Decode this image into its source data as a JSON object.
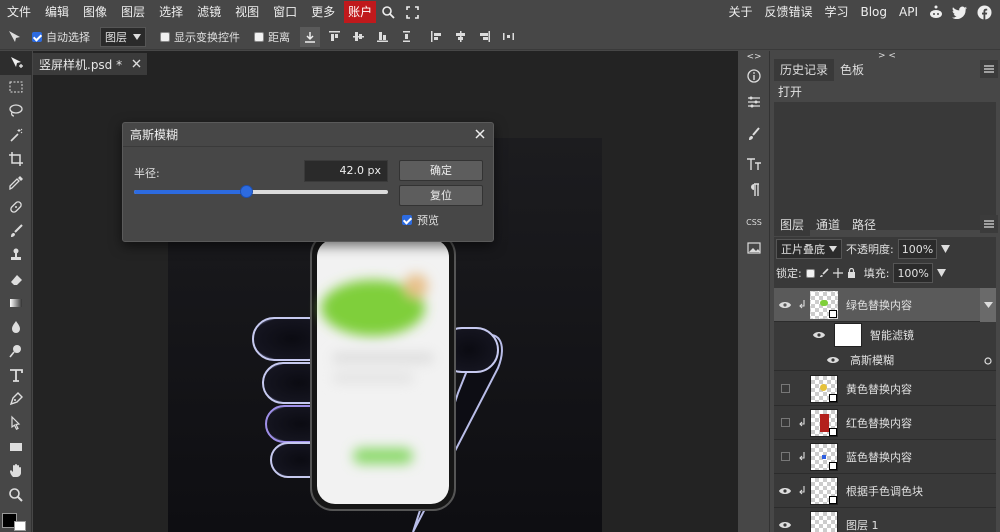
{
  "menubar": {
    "items": [
      "文件",
      "编辑",
      "图像",
      "图层",
      "选择",
      "滤镜",
      "视图",
      "窗口",
      "更多"
    ],
    "account_label": "账户",
    "right_items": [
      "关于",
      "反馈错误",
      "学习",
      "Blog",
      "API"
    ],
    "account_color": "#c0191c"
  },
  "options": {
    "auto_select_label": "自动选择",
    "auto_select_checked": true,
    "target_value": "图层",
    "show_transform_label": "显示变换控件",
    "distance_label": "距离"
  },
  "document": {
    "tab_title": "竖屏样机.psd *"
  },
  "dialog": {
    "title": "高斯模糊",
    "radius_label": "半径:",
    "radius_value": "42.0 px",
    "slider_fraction": 0.44,
    "ok_label": "确定",
    "reset_label": "复位",
    "preview_label": "预览",
    "preview_checked": true
  },
  "history_panel": {
    "tabs": [
      "历史记录",
      "色板"
    ],
    "items": [
      "打开"
    ]
  },
  "layers_panel": {
    "tabs": [
      "图层",
      "通道",
      "路径"
    ],
    "blend_mode": "正片叠底",
    "opacity_label": "不透明度:",
    "opacity_value": "100%",
    "lock_label": "锁定:",
    "fill_label": "填充:",
    "fill_value": "100%",
    "layers": [
      {
        "name": "绿色替换内容",
        "visible": true,
        "selected": true
      },
      {
        "name": "智能滤镜",
        "visible": true,
        "sub": true
      },
      {
        "name": "高斯模糊",
        "visible": true,
        "sub": true
      },
      {
        "name": "黄色替换内容",
        "visible": false
      },
      {
        "name": "红色替换内容",
        "visible": false
      },
      {
        "name": "蓝色替换内容",
        "visible": false
      },
      {
        "name": "根据手色调色块",
        "visible": true
      },
      {
        "name": "图层 1",
        "visible": true
      }
    ]
  },
  "colors": {
    "accent": "#2d6be0",
    "panel": "#474747",
    "panel_dark": "#393939"
  }
}
